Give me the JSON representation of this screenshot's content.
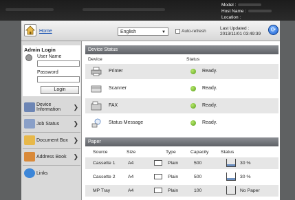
{
  "topbar": {
    "model_label": "Model :",
    "host_label": "Host Name :",
    "location_label": "Location :"
  },
  "header": {
    "home": "Home",
    "language": "English",
    "auto_refresh": "Auto-refresh",
    "last_updated_label": "Last Updated :",
    "last_updated_value": "2013/11/01 03:49:39"
  },
  "sidebar": {
    "admin_title": "Admin Login",
    "user_label": "User Name",
    "password_label": "Password",
    "login_button": "Login",
    "items": [
      {
        "label": "Device Information",
        "icon": "device-info-icon",
        "color": "#6d86b5"
      },
      {
        "label": "Job Status",
        "icon": "job-status-icon",
        "color": "#8aa0c8"
      },
      {
        "label": "Document Box",
        "icon": "document-box-icon",
        "color": "#e7b84a"
      },
      {
        "label": "Address Book",
        "icon": "address-book-icon",
        "color": "#d98a3a"
      },
      {
        "label": "Links",
        "icon": "links-icon",
        "color": "#3c86d8"
      }
    ]
  },
  "device_status": {
    "title": "Device Status",
    "col_device": "Device",
    "col_status": "Status",
    "rows": [
      {
        "name": "Printer",
        "status": "Ready."
      },
      {
        "name": "Scanner",
        "status": "Ready."
      },
      {
        "name": "FAX",
        "status": "Ready."
      },
      {
        "name": "Status Message",
        "status": "Ready."
      }
    ]
  },
  "paper": {
    "title": "Paper",
    "columns": [
      "Source",
      "Size",
      "Type",
      "Capacity",
      "Status"
    ],
    "rows": [
      {
        "source": "Cassette 1",
        "size": "A4",
        "type": "Plain",
        "capacity": "500",
        "status": "30 %",
        "level": 0.3
      },
      {
        "source": "Cassette 2",
        "size": "A4",
        "type": "Plain",
        "capacity": "500",
        "status": "30 %",
        "level": 0.3
      },
      {
        "source": "MP Tray",
        "size": "A4",
        "type": "Plain",
        "capacity": "100",
        "status": "No Paper",
        "level": 0
      }
    ]
  }
}
